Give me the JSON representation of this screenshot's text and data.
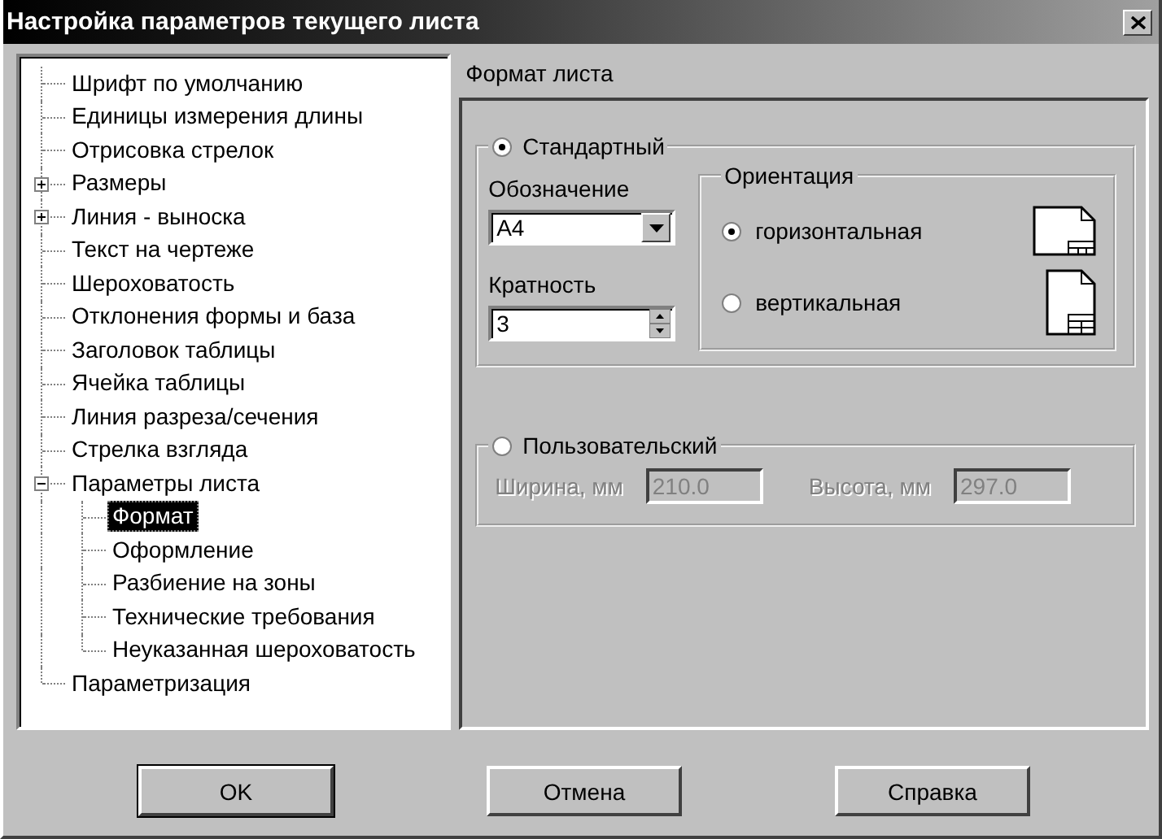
{
  "window": {
    "title": "Настройка параметров текущего листа"
  },
  "tree": {
    "items": [
      {
        "label": "Шрифт по умолчанию",
        "selected": false
      },
      {
        "label": "Единицы измерения длины",
        "selected": false
      },
      {
        "label": "Отрисовка стрелок",
        "selected": false
      },
      {
        "label": "Размеры",
        "selected": false,
        "expanded": false
      },
      {
        "label": "Линия - выноска",
        "selected": false,
        "expanded": false
      },
      {
        "label": "Текст на чертеже",
        "selected": false
      },
      {
        "label": "Шероховатость",
        "selected": false
      },
      {
        "label": "Отклонения формы и база",
        "selected": false
      },
      {
        "label": "Заголовок таблицы",
        "selected": false
      },
      {
        "label": "Ячейка таблицы",
        "selected": false
      },
      {
        "label": "Линия разреза/сечения",
        "selected": false
      },
      {
        "label": "Стрелка взгляда",
        "selected": false
      },
      {
        "label": "Параметры листа",
        "selected": false,
        "expanded": true,
        "children": [
          {
            "label": "Формат",
            "selected": true
          },
          {
            "label": "Оформление",
            "selected": false
          },
          {
            "label": "Разбиение на зоны",
            "selected": false
          },
          {
            "label": "Технические требования",
            "selected": false
          },
          {
            "label": "Неуказанная шероховатость",
            "selected": false
          }
        ]
      },
      {
        "label": "Параметризация",
        "selected": false
      }
    ]
  },
  "panel": {
    "title": "Формат листа",
    "standard": {
      "label": "Стандартный",
      "selected": true,
      "designation": {
        "label": "Обозначение",
        "value": "A4"
      },
      "multiplicity": {
        "label": "Кратность",
        "value": "3"
      },
      "orientation": {
        "title": "Ориентация",
        "options": [
          {
            "label": "горизонтальная",
            "selected": true,
            "kind": "landscape"
          },
          {
            "label": "вертикальная",
            "selected": false,
            "kind": "portrait"
          }
        ]
      }
    },
    "custom": {
      "label": "Пользовательский",
      "selected": false,
      "disabled": true,
      "width": {
        "label": "Ширина, мм",
        "value": "210.0"
      },
      "height": {
        "label": "Высота, мм",
        "value": "297.0"
      }
    }
  },
  "buttons": [
    {
      "label": "OK",
      "default": true
    },
    {
      "label": "Отмена",
      "default": false
    },
    {
      "label": "Справка",
      "default": false
    }
  ]
}
